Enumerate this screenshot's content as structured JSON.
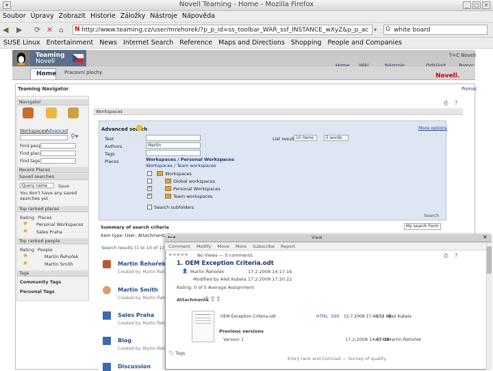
{
  "window": {
    "title": "Novell Teaming - Home - Mozilla Firefox"
  },
  "menu": [
    "Soubor",
    "Úpravy",
    "Zobrazit",
    "Historie",
    "Záložky",
    "Nástroje",
    "Nápověda"
  ],
  "address": {
    "url": "http://www.teaming.cz/user/mrehorek/?p_p_id=ss_toolbar_WAR_ssf_INSTANCE_wXyZ&p_p_action=1"
  },
  "search": {
    "value": "white board"
  },
  "bookmarks": [
    "SUSE Linux",
    "Entertainment",
    "News",
    "Internet Search",
    "Reference",
    "Maps and Directions",
    "Shopping",
    "People and Companies"
  ],
  "header": {
    "logo_line1": "Teaming",
    "logo_line2": "Novell",
    "brand_right": "T+C Novell",
    "novell_mark": "Novell.",
    "links": [
      "Home",
      "Wiki",
      "Nástroje",
      "Odhlásit"
    ]
  },
  "tabs": {
    "home": "Home",
    "second": "Pracovní plochy"
  },
  "navigator": {
    "title": "Teaming Navigator",
    "help": "Pomoc",
    "panel_title": "Navigator",
    "links": [
      "Workspaces",
      "Advanced"
    ],
    "fields": [
      "Find people",
      "Find places",
      "Find tags"
    ],
    "recent_places": "Recent Places",
    "saved_searches": "Saved searches",
    "query_name": "Query name",
    "save": "Save",
    "no_saved": "You don't have any saved searches yet",
    "top_places": "Top ranked places",
    "rating": "Rating",
    "places": "Places",
    "place1": "Personal Workspaces",
    "place2": "Sales Praha",
    "top_people": "Top ranked people",
    "people": "People",
    "person1": "Martin Řehořek",
    "person2": "Martin Smith",
    "tags": "Tags",
    "community_tags": "Community Tags",
    "personal_tags": "Personal Tags"
  },
  "workspace_crumb": "Workspaces",
  "advanced_search": {
    "title": "Advanced search",
    "more_options": "More options",
    "labels": [
      "Text",
      "Authors",
      "Tags",
      "Places"
    ],
    "authors_value": "Martin",
    "place_path": "Workspaces / Personal Workspaces",
    "place_sub": "Workspaces / Team workspaces",
    "list_results": "List results",
    "items_value": "10 items",
    "words_value": "5 words",
    "tree": [
      "Workspaces",
      "Global workspaces",
      "Personal Workspaces",
      "Team workspaces"
    ],
    "subfolders": "Search subfolders",
    "search_btn": "Search"
  },
  "summary": {
    "title": "Summary of search criteria",
    "item_type": "Item type: User, Attachment, Com...",
    "my_search": "My search Form"
  },
  "results": {
    "count": "Search results [1 to 10 of 13]",
    "items": [
      {
        "name": "Martin Řehořek",
        "by": "Created by: Martin Řehořek"
      },
      {
        "name": "Martin Smith",
        "by": "Created by: Martin Řehořek"
      },
      {
        "name": "Sales Praha",
        "by": "Created by: Martin Řehořek"
      },
      {
        "name": "Blog",
        "by": "Created by: Martin Řehořek"
      },
      {
        "name": "Discussion",
        "by": "Created by: Martin Řehořek"
      }
    ]
  },
  "popup": {
    "title": "View",
    "tabs": [
      "Comment",
      "Modify",
      "Move",
      "More",
      "Subscribe",
      "Report"
    ],
    "rating_text": "No Views — 0 comments",
    "doc_title": "1. OEM Exception Criteria.odt",
    "author": "Martin Řehořek",
    "date1": "17.2.2008 14:17:16",
    "modified_by": "Modified by",
    "modifier": "Aleš Kubela",
    "date2": "17.2.2008 17:20:22",
    "rating_line": "Rating: 0 of 5 Average Assignment",
    "attachments": "Attachments",
    "att_name": "OEM Exception Criteria.odt",
    "att_html": "HTML",
    "att_edit": "Edit",
    "att_date": "15.7.2008 17:48:51",
    "att_size": "132 KB",
    "att_user": "Aleš Kubela",
    "previous": "Previous versions",
    "version": "Version 1",
    "ver_date": "17.2.2008 14:17:16",
    "ver_size": "40 KB",
    "ver_user": "Martin Řehořek",
    "tags": "Tags",
    "footer": "Entry rank and Contrast — Survey of quality"
  },
  "colors": {
    "accent": "#224a8f",
    "panel": "#dde6f2",
    "novell_red": "#cc0000"
  }
}
